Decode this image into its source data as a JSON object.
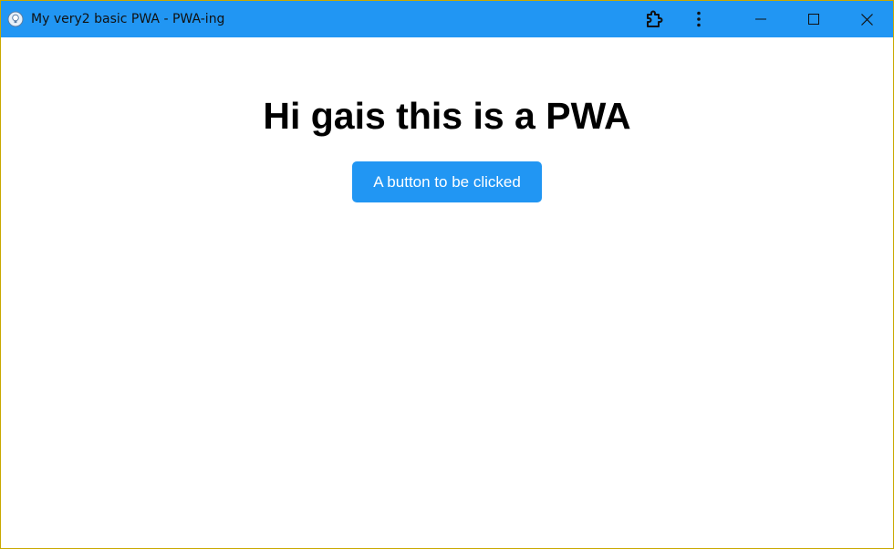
{
  "window": {
    "title": "My very2 basic PWA - PWA-ing",
    "titlebar_color": "#2196f3",
    "icons": {
      "app": "app-bulb-icon",
      "extension": "puzzle-icon",
      "menu": "more-vertical-icon",
      "minimize": "minimize-icon",
      "maximize": "maximize-icon",
      "close": "close-icon"
    }
  },
  "main": {
    "heading": "Hi gais this is a PWA",
    "button_label": "A button to be clicked",
    "button_color": "#2196f3"
  }
}
